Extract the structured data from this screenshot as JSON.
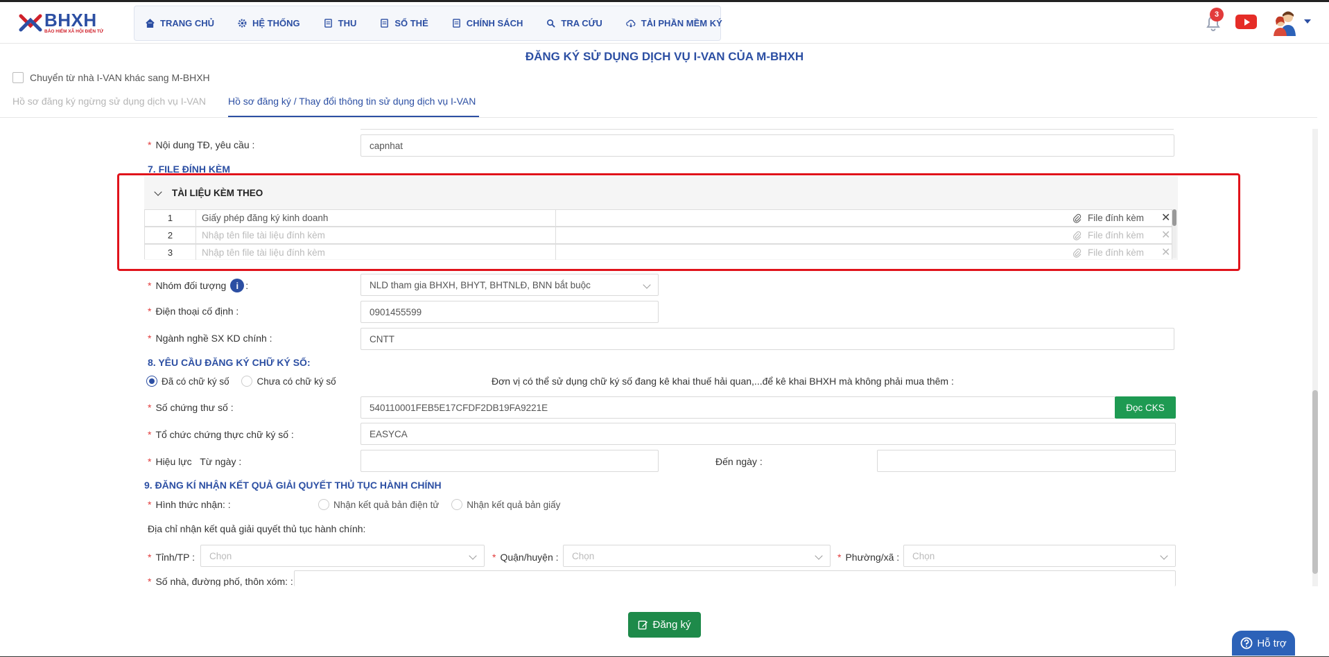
{
  "header": {
    "logo": {
      "big": "BHXH",
      "small": "BẢO HIỂM XÃ HỘI ĐIỆN TỬ"
    },
    "nav": [
      {
        "label": "TRANG CHỦ",
        "icon": "home-icon"
      },
      {
        "label": "HỆ THỐNG",
        "icon": "gear-icon"
      },
      {
        "label": "THU",
        "icon": "document-icon"
      },
      {
        "label": "SỔ THẺ",
        "icon": "document-icon"
      },
      {
        "label": "CHÍNH SÁCH",
        "icon": "document-icon"
      },
      {
        "label": "TRA CỨU",
        "icon": "search-icon"
      },
      {
        "label": "TẢI PHẦN MỀM KÝ",
        "icon": "download-cloud-icon"
      }
    ],
    "notification_count": "3",
    "colors": {
      "brand": "#2c4fa3",
      "youtube": "#e52d27",
      "badge": "#e23b3b"
    }
  },
  "page": {
    "title": "ĐĂNG KÝ SỬ DỤNG DỊCH VỤ I-VAN CỦA M-BHXH",
    "switch_checkbox_label": "Chuyển từ nhà I-VAN khác sang M-BHXH",
    "tabs": [
      {
        "label": "Hồ sơ đăng ký ngừng sử dụng dịch vụ I-VAN",
        "active": false
      },
      {
        "label": "Hồ sơ đăng ký / Thay đổi thông tin sử dụng dịch vụ I-VAN",
        "active": true
      }
    ]
  },
  "form": {
    "content_change": {
      "label": "Nội dung TĐ, yêu cầu",
      "value": "capnhat"
    },
    "section7": "7. FILE ĐÍNH KÈM",
    "attachments": {
      "heading": "TÀI LIỆU KÈM THEO",
      "file_label": "File đính kèm",
      "rows": [
        {
          "num": "1",
          "name": "Giấy phép đăng ký kinh doanh",
          "placeholder": false
        },
        {
          "num": "2",
          "name": "Nhập tên file tài liệu đính kèm",
          "placeholder": true
        },
        {
          "num": "3",
          "name": "Nhập tên file tài liệu đính kèm",
          "placeholder": true
        }
      ]
    },
    "target_group": {
      "label": "Nhóm đối tượng",
      "value": "NLD tham gia BHXH, BHYT, BHTNLĐ, BNN bắt buộc"
    },
    "landline": {
      "label": "Điện thoại cố định",
      "value": "0901455599"
    },
    "main_business": {
      "label": "Ngành nghề SX KD chính",
      "value": "CNTT"
    },
    "section8": "8. YÊU CẦU ĐĂNG KÝ CHỮ KÝ SỐ:",
    "signature_options": [
      {
        "label": "Đã có chữ ký số",
        "selected": true
      },
      {
        "label": "Chưa có chữ ký số",
        "selected": false
      }
    ],
    "signature_note": "Đơn vị có thể sử dụng chữ ký số đang kê khai thuế hải quan,...để kê khai BHXH mà không phải mua thêm",
    "cert_serial": {
      "label": "Số chứng thư số",
      "value": "540110001FEB5E17CFDF2DB19FA9221E",
      "button": "Đọc CKS"
    },
    "cert_org": {
      "label": "Tổ chức chứng thực chữ ký số",
      "value": "EASYCA"
    },
    "validity": {
      "label": "Hiệu lực",
      "from_label": "Từ ngày",
      "to_label": "Đến ngày"
    },
    "section9": "9. ĐĂNG KÍ NHẬN KẾT QUẢ GIẢI QUYẾT THỦ TỤC HÀNH CHÍNH",
    "receive_method": {
      "label": "Hình thức nhận:",
      "options": [
        "Nhận kết quả bản điện tử",
        "Nhận kết quả bản giấy"
      ]
    },
    "address_label": "Địa chỉ nhận kết quả giải quyết thủ tục hành chính:",
    "province": {
      "label": "Tỉnh/TP",
      "placeholder": "Chọn"
    },
    "district": {
      "label": "Quận/huyện",
      "placeholder": "Chọn"
    },
    "ward": {
      "label": "Phường/xã",
      "placeholder": "Chọn"
    },
    "street": {
      "label": "Số nhà, đường phố, thôn xóm:"
    }
  },
  "actions": {
    "submit": "Đăng ký",
    "support": "Hỗ trợ"
  }
}
